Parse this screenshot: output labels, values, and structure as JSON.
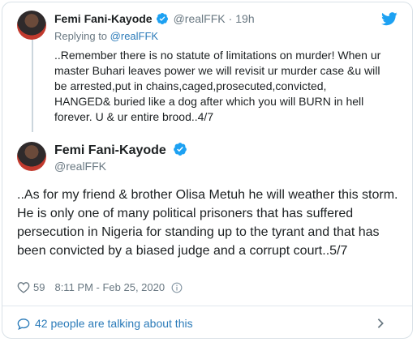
{
  "reply": {
    "author_name": "Femi Fani-Kayode",
    "handle": "@realFFK",
    "separator": "·",
    "time": "19h",
    "replying_prefix": "Replying to",
    "replying_handle": "@realFFK",
    "text": "..Remember there is no statute of limitations on murder! When ur master Buhari leaves power we will revisit ur murder case &u will be arrested,put in chains,caged,prosecuted,convicted, HANGED& buried like a dog after which you will BURN in hell forever. U & ur entire brood..4/7"
  },
  "tweet": {
    "author_name": "Femi Fani-Kayode",
    "handle": "@realFFK",
    "text": "..As for my friend & brother Olisa Metuh he will weather this storm. He is only one of many political prisoners that has suffered persecution in Nigeria for standing up to the tyrant and that has been convicted by a biased judge and a corrupt court..5/7",
    "likes": "59",
    "timestamp": "8:11 PM - Feb 25, 2020"
  },
  "footer": {
    "talk_label": "42 people are talking about this"
  },
  "colors": {
    "accent": "#1da1f2",
    "link": "#2b7bb9",
    "muted": "#697882",
    "border": "#d9e1e7"
  },
  "icons": [
    "verified-badge-icon",
    "twitter-bird-icon",
    "heart-icon",
    "info-icon",
    "speech-bubble-icon",
    "chevron-right-icon"
  ]
}
